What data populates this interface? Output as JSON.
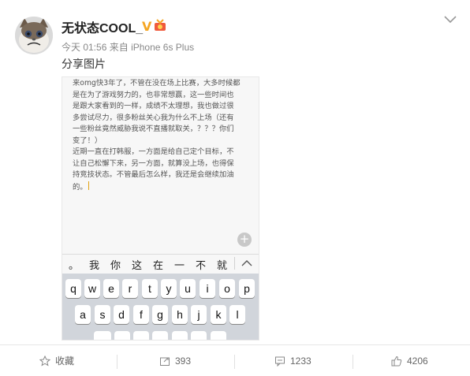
{
  "post": {
    "username": "无状态COOL_",
    "verified_badge": "V",
    "time": "今天 01:56",
    "source_prefix": "来自",
    "source": "iPhone 6s Plus",
    "text": "分享图片"
  },
  "screenshot": {
    "note_lines": [
      "来omg快3年了，不管在没在场上比赛，大多时候都",
      "是在为了游戏努力的，也非常想赢，这一些时间也",
      "是跟大家看到的一样，成绩不太理想，我也做过很",
      "多尝试尽力，很多粉丝关心我为什么不上场（还有",
      "一些粉丝竟然威胁我说不直播就取关，？？？你们",
      "变了！）",
      "近期一直在打韩服，一方面是给自己定个目标，不",
      "让自己松懈下来，另一方面，就算没上场，也得保",
      "持竞技状态。不管最后怎么样，我还是会继续加油",
      "的。"
    ],
    "candidates": [
      "。",
      "我",
      "你",
      "这",
      "在",
      "一",
      "不",
      "就"
    ],
    "keyboard_row1": [
      "q",
      "w",
      "e",
      "r",
      "t",
      "y",
      "u",
      "i",
      "o",
      "p"
    ],
    "keyboard_row2": [
      "a",
      "s",
      "d",
      "f",
      "g",
      "h",
      "j",
      "k",
      "l"
    ]
  },
  "actions": {
    "favorite_label": "收藏",
    "repost_count": "393",
    "comment_count": "1233",
    "like_count": "4206"
  },
  "colors": {
    "accent_badge": "#f5a623",
    "cursor": "#e3a313"
  }
}
